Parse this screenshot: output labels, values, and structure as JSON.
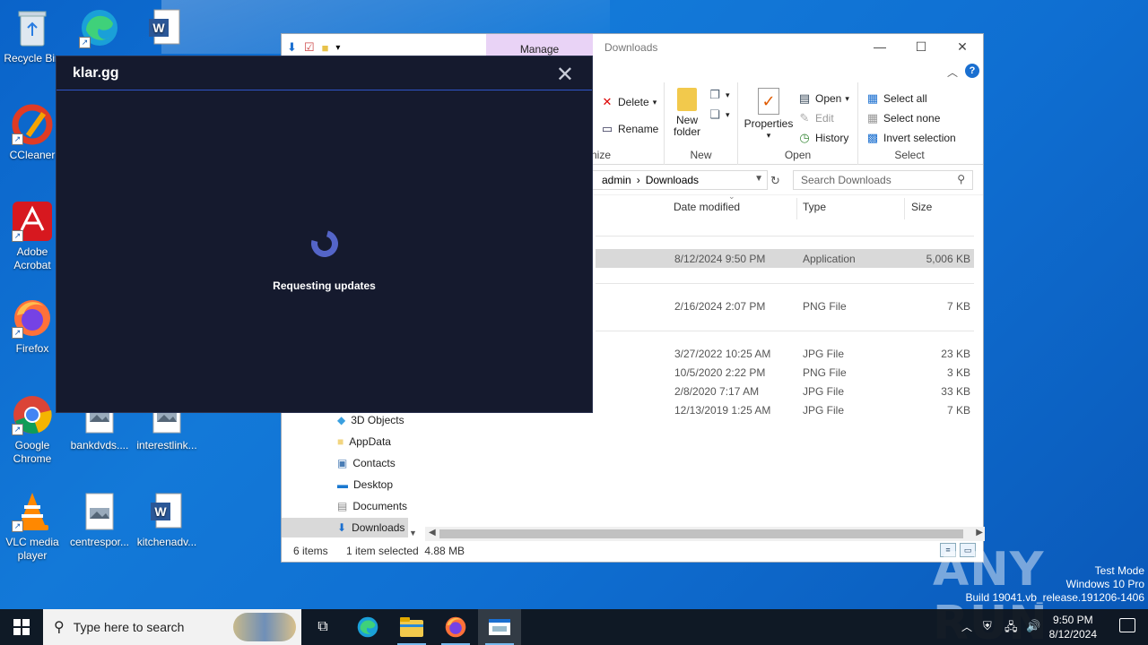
{
  "desktop": {
    "icons": [
      {
        "label": "Recycle Bin"
      },
      {
        "label": "CCleaner"
      },
      {
        "label": "Adobe Acrobat"
      },
      {
        "label": "Firefox"
      },
      {
        "label": "Google Chrome"
      },
      {
        "label": "VLC media player"
      },
      {
        "label": "bankdvds...."
      },
      {
        "label": "interestlink..."
      },
      {
        "label": "centrespor..."
      },
      {
        "label": "kitchenadv..."
      }
    ]
  },
  "explorer": {
    "manage_tab": "Manage",
    "title": "Downloads",
    "ribbon": {
      "organize": {
        "delete": "Delete",
        "rename": "Rename",
        "title_fragment": "nize"
      },
      "new": {
        "new_folder_line1": "New",
        "new_folder_line2": "folder",
        "title": "New"
      },
      "open": {
        "properties": "Properties",
        "open": "Open",
        "edit": "Edit",
        "history": "History",
        "title": "Open"
      },
      "select": {
        "select_all": "Select all",
        "select_none": "Select none",
        "invert": "Invert selection",
        "title": "Select"
      }
    },
    "address": {
      "crumb1": "admin",
      "sep": "›",
      "crumb2": "Downloads"
    },
    "search": {
      "placeholder": "Search Downloads"
    },
    "columns": {
      "date": "Date modified",
      "type": "Type",
      "size": "Size"
    },
    "files": [
      {
        "date": "8/12/2024 9:50 PM",
        "type": "Application",
        "size": "5,006 KB"
      },
      {
        "date": "2/16/2024 2:07 PM",
        "type": "PNG File",
        "size": "7 KB"
      },
      {
        "date": "3/27/2022 10:25 AM",
        "type": "JPG File",
        "size": "23 KB"
      },
      {
        "date": "10/5/2020 2:22 PM",
        "type": "PNG File",
        "size": "3 KB"
      },
      {
        "date": "2/8/2020 7:17 AM",
        "type": "JPG File",
        "size": "33 KB"
      },
      {
        "date": "12/13/2019 1:25 AM",
        "type": "JPG File",
        "size": "7 KB"
      }
    ],
    "nav": [
      {
        "label": "3D Objects"
      },
      {
        "label": "AppData"
      },
      {
        "label": "Contacts"
      },
      {
        "label": "Desktop"
      },
      {
        "label": "Documents"
      },
      {
        "label": "Downloads"
      }
    ],
    "status": {
      "items": "6 items",
      "selected": "1 item selected  4.88 MB"
    }
  },
  "dialog": {
    "title": "klar.gg",
    "status": "Requesting updates",
    "close_glyph": "✕"
  },
  "taskbar": {
    "search_placeholder": "Type here to search",
    "time": "9:50 PM",
    "date": "8/12/2024"
  },
  "watermark": {
    "brand": "ANY RUN",
    "line1": "Test Mode",
    "line2": "Windows 10 Pro",
    "line3": "Build 19041.vb_release.191206-1406"
  },
  "colors": {
    "desktop": "#1275d6",
    "dialog_bg": "#151a2e",
    "spinner": "#5465c8",
    "manage_tab": "#e9d3f6",
    "selected_row": "#d9d9d9"
  }
}
